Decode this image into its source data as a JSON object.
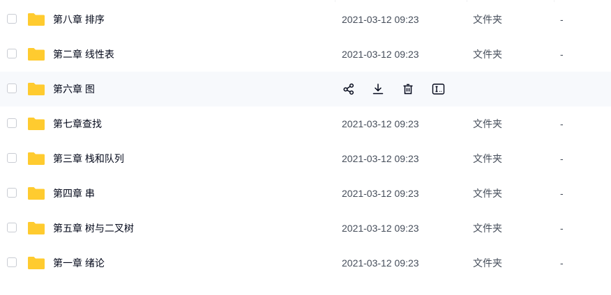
{
  "icons": {
    "folder": "folder-icon",
    "share": "share-icon",
    "download": "download-icon",
    "delete": "trash-icon",
    "rename": "rename-icon"
  },
  "colors": {
    "folder": "#ffcb2f",
    "folder_tab": "#ffd34d",
    "hover_row": "#f7f9fc",
    "text_primary": "#03081a",
    "text_secondary": "#454d5a"
  },
  "files": [
    {
      "name": "第八章 排序",
      "modified": "2021-03-12 09:23",
      "type": "文件夹",
      "size": "-"
    },
    {
      "name": "第二章 线性表",
      "modified": "2021-03-12 09:23",
      "type": "文件夹",
      "size": "-"
    },
    {
      "name": "第六章 图",
      "modified": "",
      "type": "",
      "size": ""
    },
    {
      "name": "第七章查找",
      "modified": "2021-03-12 09:23",
      "type": "文件夹",
      "size": "-"
    },
    {
      "name": "第三章 栈和队列",
      "modified": "2021-03-12 09:23",
      "type": "文件夹",
      "size": "-"
    },
    {
      "name": "第四章 串",
      "modified": "2021-03-12 09:23",
      "type": "文件夹",
      "size": "-"
    },
    {
      "name": "第五章 树与二叉树",
      "modified": "2021-03-12 09:23",
      "type": "文件夹",
      "size": "-"
    },
    {
      "name": "第一章 绪论",
      "modified": "2021-03-12 09:23",
      "type": "文件夹",
      "size": "-"
    }
  ]
}
